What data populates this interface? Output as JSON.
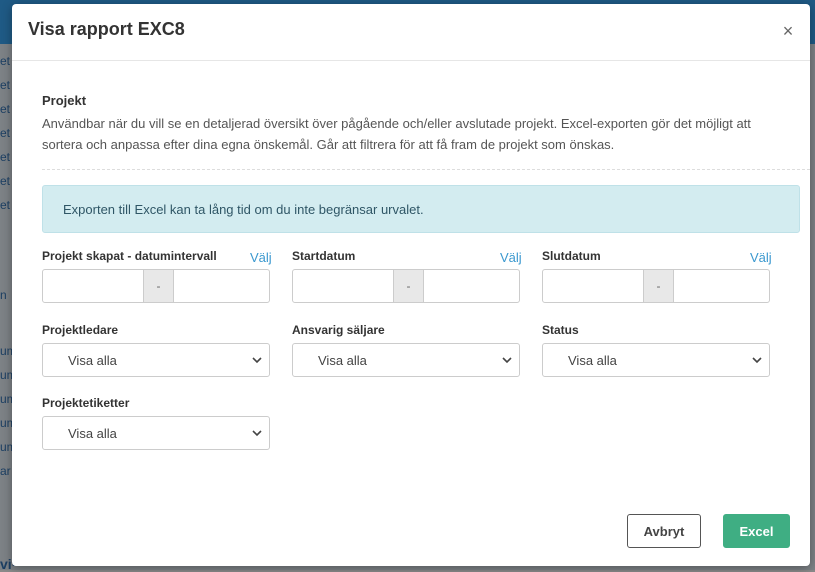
{
  "modal": {
    "title": "Visa rapport EXC8",
    "close_glyph": "×"
  },
  "section": {
    "title": "Projekt",
    "description": "Användbar när du vill se en detaljerad översikt över pågående och/eller avslutade projekt. Excel-exporten gör det möjligt att sortera och anpassa efter dina egna önskemål. Går att filtrera för att få fram de projekt som önskas."
  },
  "alert": {
    "text": "Exporten till Excel kan ta lång tid om du inte begränsar urvalet."
  },
  "date_fields": [
    {
      "label": "Projekt skapat - datumintervall",
      "link": "Välj",
      "separator": "-",
      "start": "",
      "end": ""
    },
    {
      "label": "Startdatum",
      "link": "Välj",
      "separator": "-",
      "start": "",
      "end": ""
    },
    {
      "label": "Slutdatum",
      "link": "Välj",
      "separator": "-",
      "start": "",
      "end": ""
    }
  ],
  "select_fields": [
    {
      "label": "Projektledare",
      "value": "Visa alla",
      "icon": "chevron-down-icon"
    },
    {
      "label": "Ansvarig säljare",
      "value": "Visa alla",
      "icon": "chevron-down-icon"
    },
    {
      "label": "Status",
      "value": "Visa alla",
      "icon": "chevron-down-icon"
    },
    {
      "label": "Projektetiketter",
      "value": "Visa alla",
      "icon": "chevron-down-icon"
    }
  ],
  "buttons": {
    "cancel": "Avbryt",
    "excel": "Excel"
  },
  "colors": {
    "accent_link": "#3a98cf",
    "primary_button": "#3fae83",
    "alert_bg": "#d3ecf0",
    "backdrop_header": "#1f5a85"
  },
  "background": {
    "left_fragments": [
      "et",
      "et",
      "et",
      "et",
      "et",
      "et",
      "et",
      "n",
      "um",
      "um",
      "um",
      "um",
      "um",
      "ar",
      "vitten"
    ]
  }
}
